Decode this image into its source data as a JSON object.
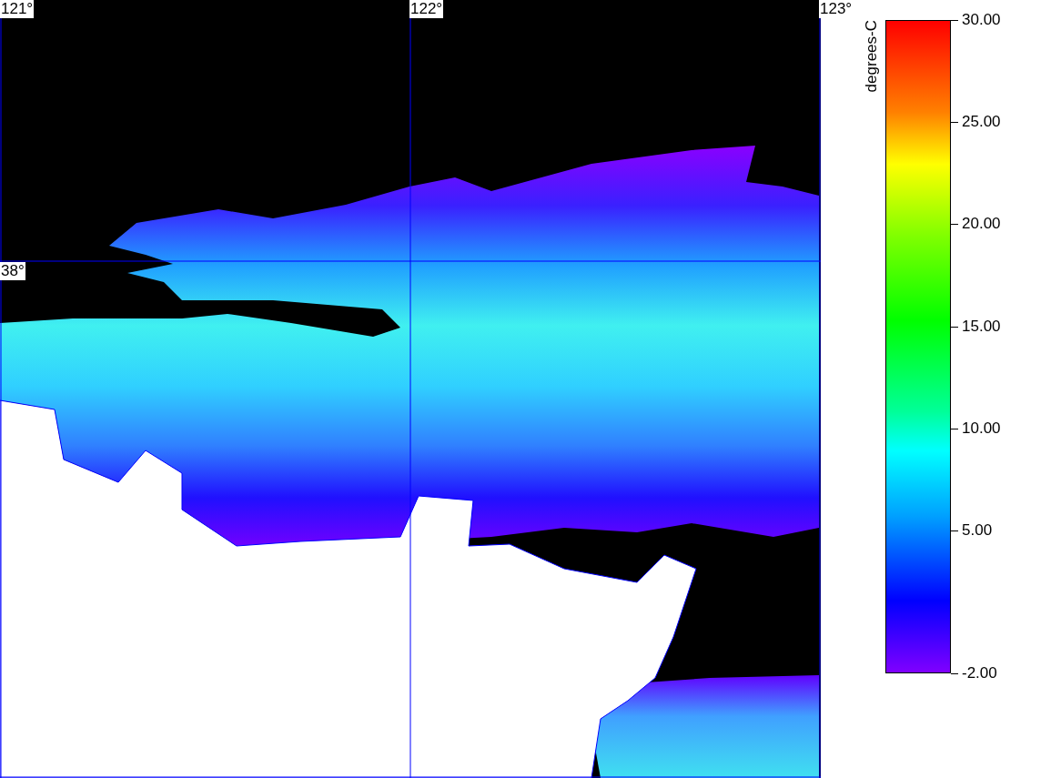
{
  "map": {
    "longitude_labels": [
      "121°",
      "122°",
      "123°"
    ],
    "latitude_labels": [
      "38°"
    ]
  },
  "colorbar": {
    "unit": "degrees-C",
    "ticks": [
      "30.00",
      "25.00",
      "20.00",
      "15.00",
      "10.00",
      "5.00",
      "-2.00"
    ]
  }
}
